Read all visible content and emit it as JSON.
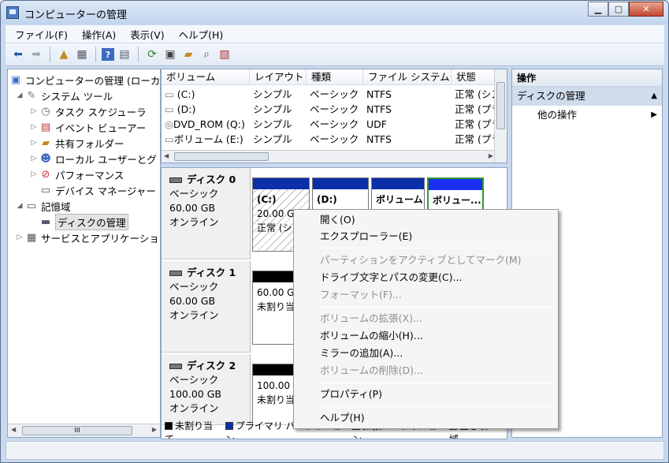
{
  "window": {
    "title": "コンピューターの管理",
    "min_label": "▁",
    "max_label": "▢",
    "close_label": "✕"
  },
  "menubar": [
    "ファイル(F)",
    "操作(A)",
    "表示(V)",
    "ヘルプ(H)"
  ],
  "toolbar_icons": [
    "back-icon",
    "forward-icon",
    "up-icon",
    "show-tree-icon",
    "help-icon",
    "show-action-icon",
    "refresh-icon",
    "properties-icon",
    "open-icon",
    "search-icon",
    "export-icon"
  ],
  "tree": {
    "items": [
      {
        "label": "コンピューターの管理 (ローカ",
        "icon": "computer-management-icon"
      },
      {
        "label": "システム ツール",
        "icon": "tools-icon"
      },
      {
        "label": "タスク スケジューラ",
        "icon": "clock-icon"
      },
      {
        "label": "イベント ビューアー",
        "icon": "event-viewer-icon"
      },
      {
        "label": "共有フォルダー",
        "icon": "shared-folder-icon"
      },
      {
        "label": "ローカル ユーザーとグ",
        "icon": "users-icon"
      },
      {
        "label": "パフォーマンス",
        "icon": "performance-icon"
      },
      {
        "label": "デバイス マネージャー",
        "icon": "device-manager-icon"
      },
      {
        "label": "記憶域",
        "icon": "storage-icon"
      },
      {
        "label": "ディスクの管理",
        "icon": "disk-management-icon"
      },
      {
        "label": "サービスとアプリケーショ",
        "icon": "services-icon"
      }
    ],
    "scroll_thumb": "III"
  },
  "volumes": {
    "headers": [
      "ボリューム",
      "レイアウト",
      "種類",
      "ファイル システム",
      "状態"
    ],
    "rows": [
      [
        "(C:)",
        "シンプル",
        "ベーシック",
        "NTFS",
        "正常 (シス"
      ],
      [
        "(D:)",
        "シンプル",
        "ベーシック",
        "NTFS",
        "正常 (プラ"
      ],
      [
        "DVD_ROM (Q:)",
        "シンプル",
        "ベーシック",
        "UDF",
        "正常 (プラ"
      ],
      [
        "ボリューム (E:)",
        "シンプル",
        "ベーシック",
        "NTFS",
        "正常 (プラ"
      ]
    ]
  },
  "disks": [
    {
      "name": "ディスク 0",
      "type": "ベーシック",
      "size": "60.00 GB",
      "status": "オンライン",
      "partitions": [
        {
          "title": "(C:)",
          "l1": "20.00 G",
          "l2": "正常 (シ"
        },
        {
          "title": "(D:)",
          "l1": "",
          "l2": ""
        },
        {
          "title": "ボリューム",
          "l1": "",
          "l2": ""
        },
        {
          "title": "ボリュー...",
          "l1": "",
          "l2": ""
        }
      ]
    },
    {
      "name": "ディスク 1",
      "type": "ベーシック",
      "size": "60.00 GB",
      "status": "オンライン",
      "partitions": [
        {
          "title": "",
          "l1": "60.00 G",
          "l2": "未割り当"
        }
      ]
    },
    {
      "name": "ディスク 2",
      "type": "ベーシック",
      "size": "100.00 GB",
      "status": "オンライン",
      "partitions": [
        {
          "title": "",
          "l1": "100.00 ",
          "l2": "未割り当"
        }
      ]
    }
  ],
  "legend": [
    {
      "label": "未割り当て",
      "color": "#000000"
    },
    {
      "label": "プライマリ パーティション",
      "color": "#0b2fa8"
    },
    {
      "label": "拡張パーティション",
      "color": "#2c9c2c"
    },
    {
      "label": "空き領域",
      "color": "#7ccf4a"
    }
  ],
  "actions": {
    "header": "操作",
    "selected": "ディスクの管理",
    "other": "他の操作"
  },
  "context_menu": [
    {
      "label": "開く(O)",
      "enabled": true
    },
    {
      "label": "エクスプローラー(E)",
      "enabled": true
    },
    {
      "label": "パーティションをアクティブとしてマーク(M)",
      "enabled": false
    },
    {
      "label": "ドライブ文字とパスの変更(C)...",
      "enabled": true
    },
    {
      "label": "フォーマット(F)...",
      "enabled": false
    },
    {
      "label": "ボリュームの拡張(X)...",
      "enabled": false
    },
    {
      "label": "ボリュームの縮小(H)...",
      "enabled": true
    },
    {
      "label": "ミラーの追加(A)...",
      "enabled": true
    },
    {
      "label": "ボリュームの削除(D)...",
      "enabled": false
    },
    {
      "label": "プロパティ(P)",
      "enabled": true
    },
    {
      "label": "ヘルプ(H)",
      "enabled": true
    }
  ],
  "colors": {
    "primary": "#0b2fa8",
    "unallocated": "#000000",
    "selected_border": "#2c9c2c"
  }
}
